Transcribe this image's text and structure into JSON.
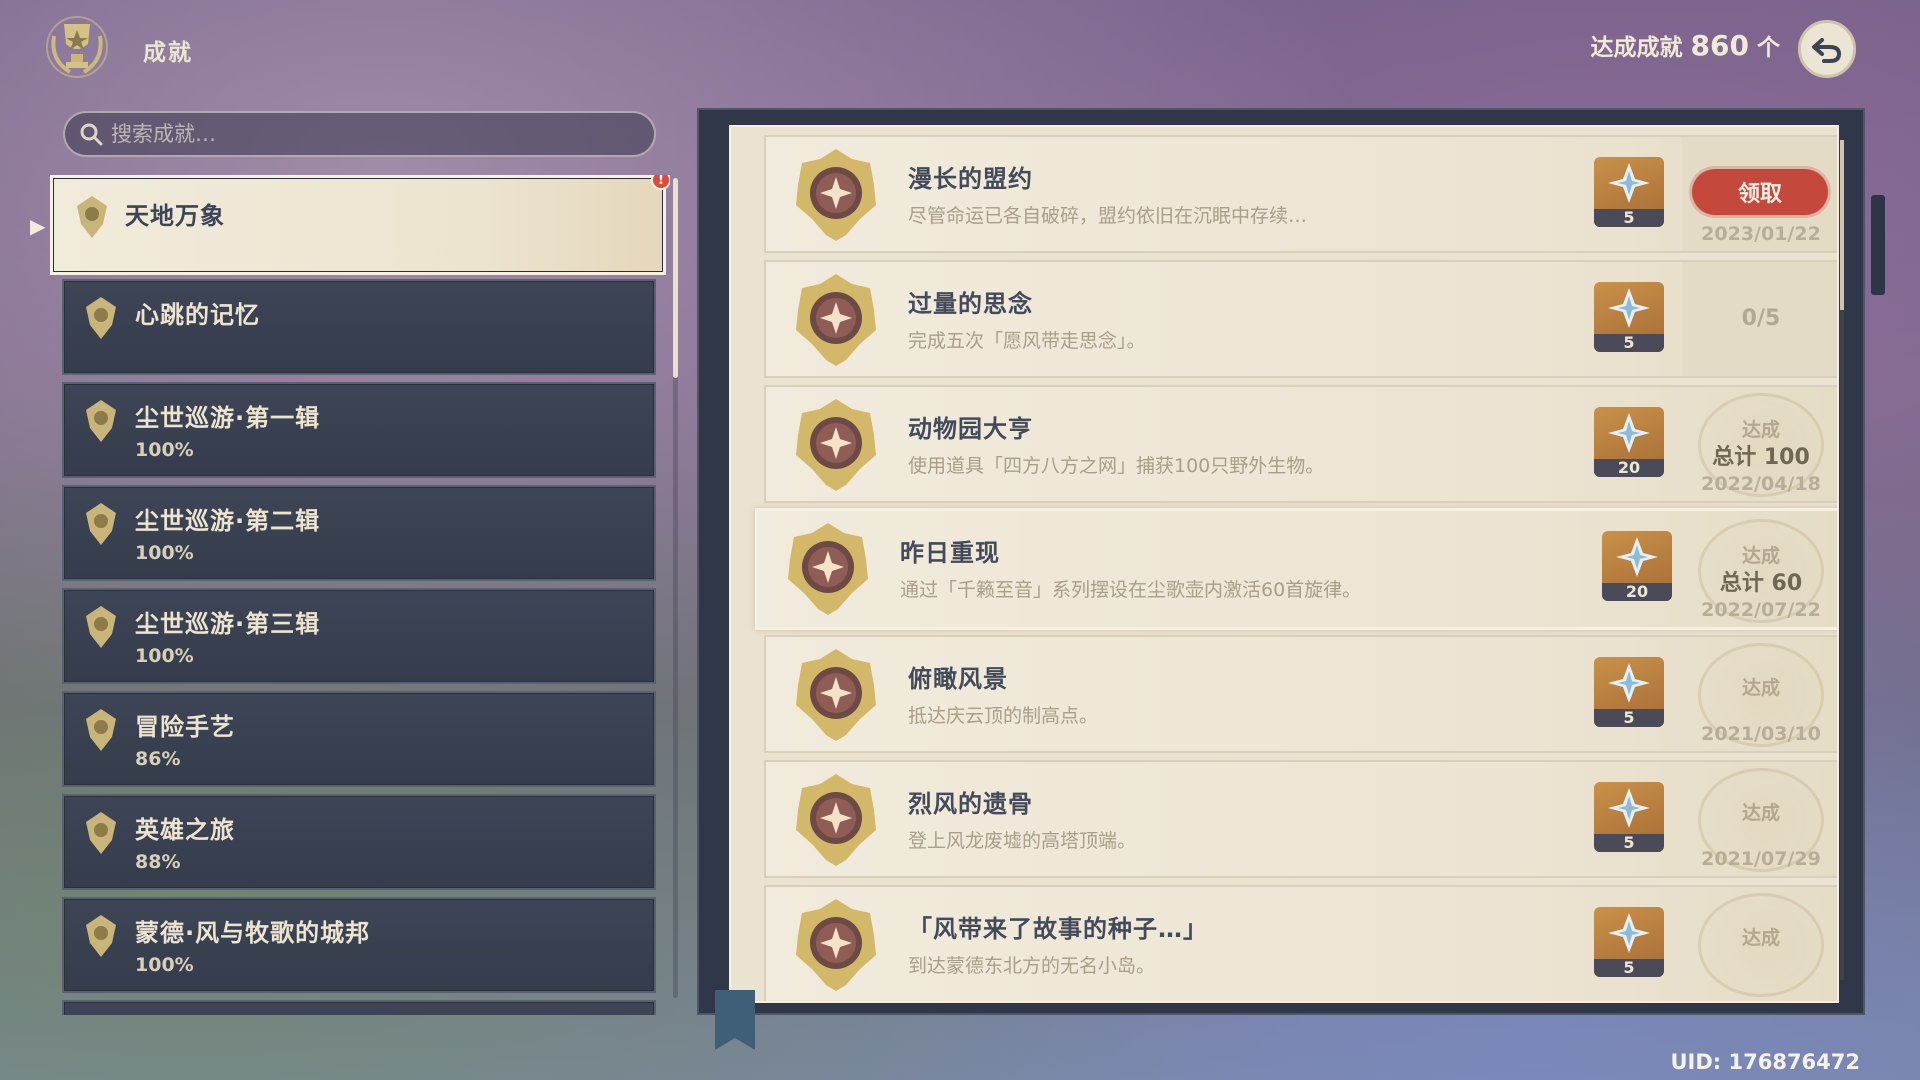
{
  "header": {
    "title": "成就",
    "count_label": "达成成就",
    "count_value": "860",
    "count_unit": "个"
  },
  "search": {
    "placeholder": "搜索成就…"
  },
  "categories": [
    {
      "name": "天地万象",
      "pct": "",
      "active": true,
      "badge": "!"
    },
    {
      "name": "心跳的记忆",
      "pct": ""
    },
    {
      "name": "尘世巡游·第一辑",
      "pct": "100%"
    },
    {
      "name": "尘世巡游·第二辑",
      "pct": "100%"
    },
    {
      "name": "尘世巡游·第三辑",
      "pct": "100%"
    },
    {
      "name": "冒险手艺",
      "pct": "86%"
    },
    {
      "name": "英雄之旅",
      "pct": "88%"
    },
    {
      "name": "蒙德·风与牧歌的城邦",
      "pct": "100%"
    }
  ],
  "achievements": [
    {
      "title": "漫长的盟约",
      "desc": "尽管命运已各自破碎，盟约依旧在沉眠中存续…",
      "reward": "5",
      "status": "claim",
      "claim_label": "领取",
      "date": "2023/01/22"
    },
    {
      "title": "过量的思念",
      "desc": "完成五次「愿风带走思念」。",
      "reward": "5",
      "status": "progress",
      "progress": "0/5"
    },
    {
      "title": "动物园大亨",
      "desc": "使用道具「四方八方之网」捕获100只野外生物。",
      "reward": "20",
      "status": "done",
      "done_label": "达成",
      "total": "总计 100",
      "date": "2022/04/18"
    },
    {
      "title": "昨日重现",
      "desc": "通过「千籁至音」系列摆设在尘歌壶内激活60首旋律。",
      "reward": "20",
      "status": "done",
      "done_label": "达成",
      "total": "总计 60",
      "date": "2022/07/22"
    },
    {
      "title": "俯瞰风景",
      "desc": "抵达庆云顶的制高点。",
      "reward": "5",
      "status": "done",
      "done_label": "达成",
      "date": "2021/03/10"
    },
    {
      "title": "烈风的遗骨",
      "desc": "登上风龙废墟的高塔顶端。",
      "reward": "5",
      "status": "done",
      "done_label": "达成",
      "date": "2021/07/29"
    },
    {
      "title": "「风带来了故事的种子…」",
      "desc": "到达蒙德东北方的无名小岛。",
      "reward": "5",
      "status": "done",
      "done_label": "达成"
    }
  ],
  "uid": "UID: 176876472",
  "colors": {
    "accent": "#c4493c",
    "panel": "#ebe3d1",
    "card": "#3d4556"
  }
}
